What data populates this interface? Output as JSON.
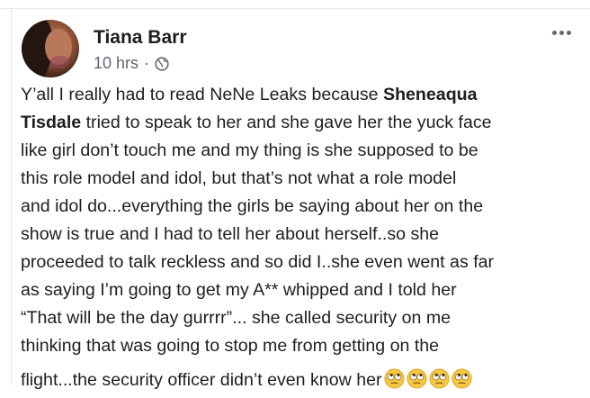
{
  "post": {
    "author": {
      "name": "Tiana Barr",
      "avatar_icon": "profile-photo"
    },
    "timestamp": "10 hrs",
    "separator": "·",
    "privacy_icon": "globe-icon",
    "more_icon": "more-horizontal-icon",
    "body_lines": [
      {
        "pre": "Y’all I really had to read NeNe Leaks because ",
        "bold": "Sheneaqua",
        "post": ""
      },
      {
        "pre": "",
        "bold": "Tisdale",
        "post": " tried to speak to her and she gave her the yuck face"
      },
      {
        "text": "like girl don’t touch me and my thing is she supposed to be"
      },
      {
        "text": "this role model and idol, but that’s not what a role model"
      },
      {
        "text": "and idol do...everything the girls be saying about her on the"
      },
      {
        "text": "show is true and I had to tell her about herself..so she"
      },
      {
        "text": "proceeded to talk reckless and so did I..she even went as far"
      },
      {
        "text": "as saying I’m going to get my A** whipped and I told her"
      },
      {
        "text": "“That will be the day gurrrr”... she called security on me"
      },
      {
        "text": "thinking that was going to stop me from getting on the"
      },
      {
        "text": "flight...the security officer didn’t even know her"
      }
    ],
    "emojis": [
      "rolling-eyes-emoji",
      "rolling-eyes-emoji",
      "rolling-eyes-emoji",
      "rolling-eyes-emoji"
    ]
  },
  "colors": {
    "text_primary": "#1c1e21",
    "text_secondary": "#606770",
    "emoji_face": "#f7c843"
  }
}
